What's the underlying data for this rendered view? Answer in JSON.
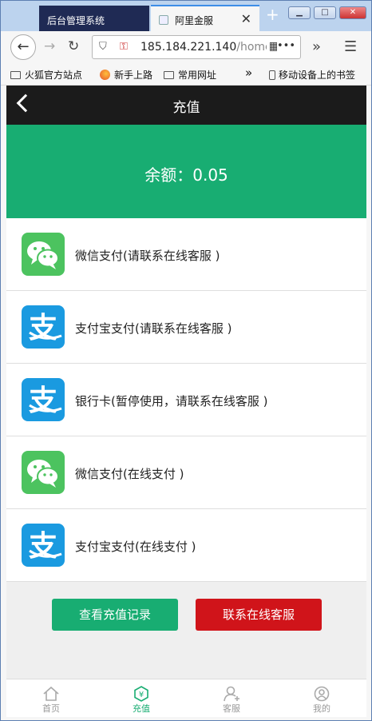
{
  "browser": {
    "tabs": [
      {
        "label": "后台管理系统"
      },
      {
        "label": "阿里金服"
      }
    ],
    "url_host": "185.184.221.140",
    "url_path": "/home/",
    "bookmarks": [
      "火狐官方站点",
      "新手上路",
      "常用网址",
      "移动设备上的书签"
    ]
  },
  "page": {
    "title": "充值",
    "balance": "余额：0.05"
  },
  "payments": [
    {
      "label": "微信支付(请联系在线客服 )",
      "icon": "wechat-pay-icon",
      "color": "#4cc35f"
    },
    {
      "label": "支付宝支付(请联系在线客服 )",
      "icon": "alipay-icon",
      "color": "#1a9ae0"
    },
    {
      "label": "银行卡(暂停使用，请联系在线客服 )",
      "icon": "alipay-icon",
      "color": "#1a9ae0"
    },
    {
      "label": "微信支付(在线支付 )",
      "icon": "wechat-pay-icon",
      "color": "#4cc35f"
    },
    {
      "label": "支付宝支付(在线支付 )",
      "icon": "alipay-icon",
      "color": "#1a9ae0"
    }
  ],
  "actions": {
    "history": "查看充值记录",
    "service": "联系在线客服",
    "green": "#18ad72",
    "red": "#d0141a"
  },
  "bottom_nav": [
    {
      "label": "首页",
      "icon": "home-icon"
    },
    {
      "label": "充值",
      "icon": "recharge-icon",
      "active": true
    },
    {
      "label": "客服",
      "icon": "customer-service-icon"
    },
    {
      "label": "我的",
      "icon": "profile-icon"
    }
  ]
}
